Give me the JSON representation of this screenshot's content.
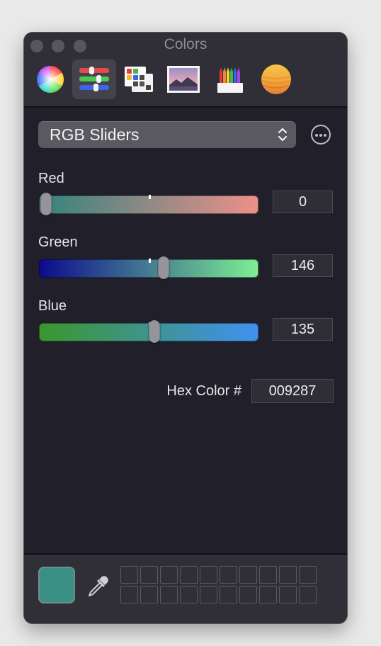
{
  "window": {
    "title": "Colors"
  },
  "toolbar": {
    "tools": [
      {
        "name": "color-wheel",
        "icon": "color-wheel-icon",
        "active": false
      },
      {
        "name": "color-sliders",
        "icon": "sliders-icon",
        "active": true
      },
      {
        "name": "color-palettes",
        "icon": "palette-icon",
        "active": false
      },
      {
        "name": "image-palettes",
        "icon": "image-icon",
        "active": false
      },
      {
        "name": "pencils",
        "icon": "pencils-icon",
        "active": false
      },
      {
        "name": "color-sphere",
        "icon": "sphere-icon",
        "active": false
      }
    ]
  },
  "mode": {
    "selected": "RGB Sliders"
  },
  "sliders": [
    {
      "label": "Red",
      "value": "0",
      "fraction": 0.0
    },
    {
      "label": "Green",
      "value": "146",
      "fraction": 0.573
    },
    {
      "label": "Blue",
      "value": "135",
      "fraction": 0.529
    }
  ],
  "hex": {
    "label": "Hex Color #",
    "value": "009287"
  },
  "current_color": "#3a8f85",
  "colors": {
    "accent": "#009287"
  },
  "swatch_wells": {
    "rows": 2,
    "columns": 10
  }
}
